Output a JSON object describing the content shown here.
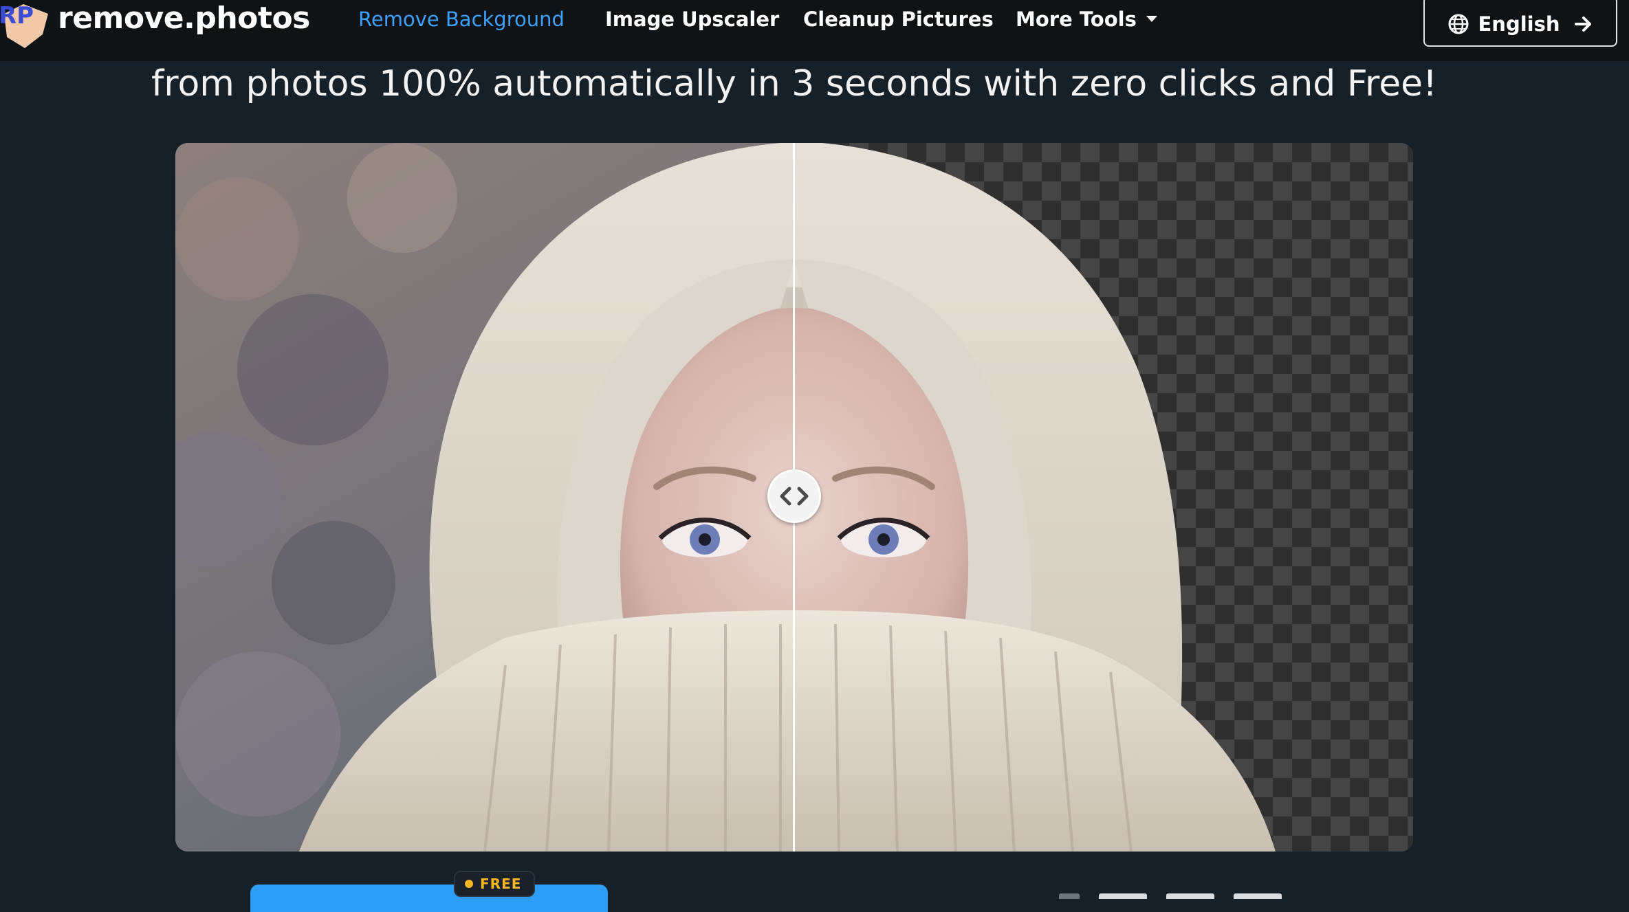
{
  "brand": {
    "name": "remove.photos",
    "mark": "RP",
    "accent": "#3ea0ff"
  },
  "nav": {
    "items": [
      {
        "label": "Remove Background",
        "active": true
      },
      {
        "label": "Image Upscaler",
        "active": false
      },
      {
        "label": "Cleanup Pictures",
        "active": false
      },
      {
        "label": "More Tools",
        "active": false,
        "dropdown": true
      }
    ],
    "language": {
      "label": "English",
      "icon": "globe-icon",
      "trailing_icon": "arrow-right-icon"
    }
  },
  "hero": {
    "headline": "from photos 100% automatically in 3 seconds with zero clicks and Free!"
  },
  "comparison": {
    "handle_icon": "chevron-left-right-icon",
    "divider_position": 0.5
  },
  "cta": {
    "badge": "FREE",
    "button_color": "#2e9df6",
    "badge_color": "#f5b623"
  }
}
